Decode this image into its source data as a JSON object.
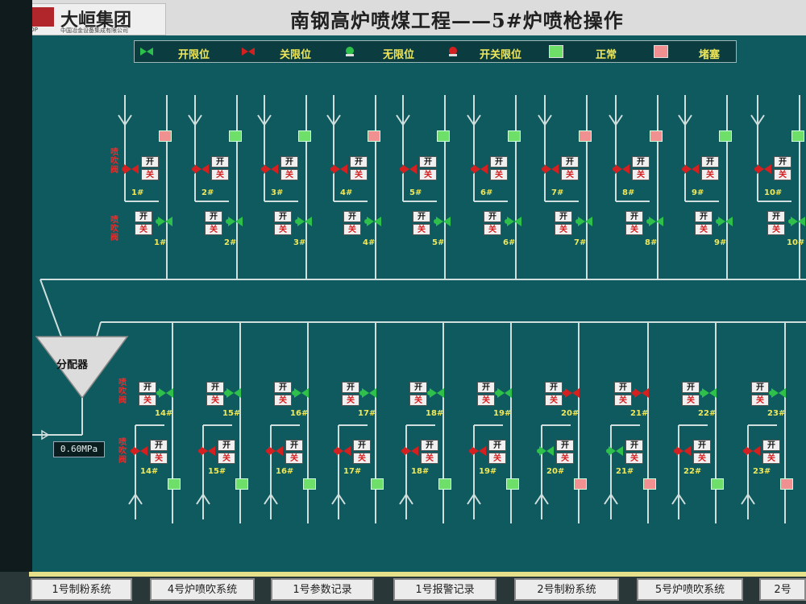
{
  "header": {
    "logo_brand": "大峘集团",
    "logo_mark_text": "MOUNTOP",
    "logo_subtitle": "中国冶金设备集成有限公司",
    "title": "南钢高炉喷煤工程——5#炉喷枪操作"
  },
  "legend": [
    {
      "label": "开限位",
      "icon": "valve-open-icon"
    },
    {
      "label": "关限位",
      "icon": "valve-closed-icon"
    },
    {
      "label": "无限位",
      "icon": "valve-none-icon"
    },
    {
      "label": "开关限位",
      "icon": "valve-both-icon"
    },
    {
      "label": "正常",
      "swatch": "#6ee06a"
    },
    {
      "label": "堵塞",
      "swatch": "#f09090"
    }
  ],
  "colors": {
    "normal": "#6ee06a",
    "blocked": "#f09090",
    "panel": "#0e5a5e",
    "pipe": "#d0dede"
  },
  "buttons": {
    "open": "开",
    "close": "关"
  },
  "upper": {
    "inlet_valve_label": "喷吹阀",
    "blow_valve_label": "喷吹阀",
    "lances": [
      {
        "id": "1#",
        "status": "blocked",
        "inlet_valve": "closed",
        "blow_valve": "open"
      },
      {
        "id": "2#",
        "status": "normal",
        "inlet_valve": "closed",
        "blow_valve": "open"
      },
      {
        "id": "3#",
        "status": "normal",
        "inlet_valve": "closed",
        "blow_valve": "open"
      },
      {
        "id": "4#",
        "status": "blocked",
        "inlet_valve": "closed",
        "blow_valve": "open"
      },
      {
        "id": "5#",
        "status": "normal",
        "inlet_valve": "closed",
        "blow_valve": "open"
      },
      {
        "id": "6#",
        "status": "normal",
        "inlet_valve": "closed",
        "blow_valve": "open"
      },
      {
        "id": "7#",
        "status": "blocked",
        "inlet_valve": "closed",
        "blow_valve": "open"
      },
      {
        "id": "8#",
        "status": "blocked",
        "inlet_valve": "closed",
        "blow_valve": "open"
      },
      {
        "id": "9#",
        "status": "normal",
        "inlet_valve": "closed",
        "blow_valve": "open"
      },
      {
        "id": "10#",
        "status": "normal",
        "inlet_valve": "closed",
        "blow_valve": "open"
      }
    ]
  },
  "lower": {
    "blow_valve_label": "喷吹阀",
    "inlet_valve_label": "喷吹阀",
    "lances": [
      {
        "id": "14#",
        "status": "normal",
        "blow_valve": "open",
        "inlet_valve": "closed"
      },
      {
        "id": "15#",
        "status": "normal",
        "blow_valve": "open",
        "inlet_valve": "closed"
      },
      {
        "id": "16#",
        "status": "normal",
        "blow_valve": "open",
        "inlet_valve": "closed"
      },
      {
        "id": "17#",
        "status": "normal",
        "blow_valve": "open",
        "inlet_valve": "closed"
      },
      {
        "id": "18#",
        "status": "normal",
        "blow_valve": "open",
        "inlet_valve": "closed"
      },
      {
        "id": "19#",
        "status": "normal",
        "blow_valve": "open",
        "inlet_valve": "closed"
      },
      {
        "id": "20#",
        "status": "blocked",
        "blow_valve": "closed",
        "inlet_valve": "open"
      },
      {
        "id": "21#",
        "status": "blocked",
        "blow_valve": "closed",
        "inlet_valve": "open"
      },
      {
        "id": "22#",
        "status": "normal",
        "blow_valve": "open",
        "inlet_valve": "closed"
      },
      {
        "id": "23#",
        "status": "blocked",
        "blow_valve": "open",
        "inlet_valve": "closed"
      }
    ]
  },
  "distributor": {
    "label": "分配器",
    "pressure": "0.60MPa"
  },
  "nav": [
    "1号制粉系统",
    "4号炉喷吹系统",
    "1号参数记录",
    "1号报警记录",
    "2号制粉系统",
    "5号炉喷吹系统",
    "2号"
  ]
}
